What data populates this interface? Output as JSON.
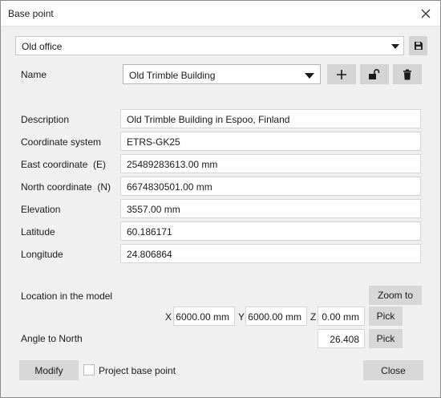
{
  "window": {
    "title": "Base point"
  },
  "preset": {
    "value": "Old office"
  },
  "name_row": {
    "label": "Name",
    "value": "Old Trimble Building"
  },
  "fields": [
    {
      "label": "Description",
      "value": "Old Trimble Building in Espoo, Finland"
    },
    {
      "label": "Coordinate system",
      "value": "ETRS-GK25"
    },
    {
      "label": "East coordinate  (E)",
      "value": "25489283613.00 mm"
    },
    {
      "label": "North coordinate  (N)",
      "value": "6674830501.00 mm"
    },
    {
      "label": "Elevation",
      "value": "3557.00 mm"
    },
    {
      "label": "Latitude",
      "value": "60.186171"
    },
    {
      "label": "Longitude",
      "value": "24.806864"
    }
  ],
  "location": {
    "label": "Location in the model",
    "zoom_label": "Zoom to",
    "x_label": "X",
    "x_value": "6000.00 mm",
    "y_label": "Y",
    "y_value": "6000.00 mm",
    "z_label": "Z",
    "z_value": "0.00 mm",
    "pick_label": "Pick"
  },
  "angle": {
    "label": "Angle to North",
    "value": "26.408",
    "pick_label": "Pick"
  },
  "footer": {
    "modify_label": "Modify",
    "project_base_label": "Project base point",
    "project_base_checked": false,
    "close_label": "Close"
  },
  "icons": [
    "save-icon",
    "plus-icon",
    "unlock-icon",
    "trash-icon",
    "close-icon",
    "chevron-down-icon"
  ]
}
